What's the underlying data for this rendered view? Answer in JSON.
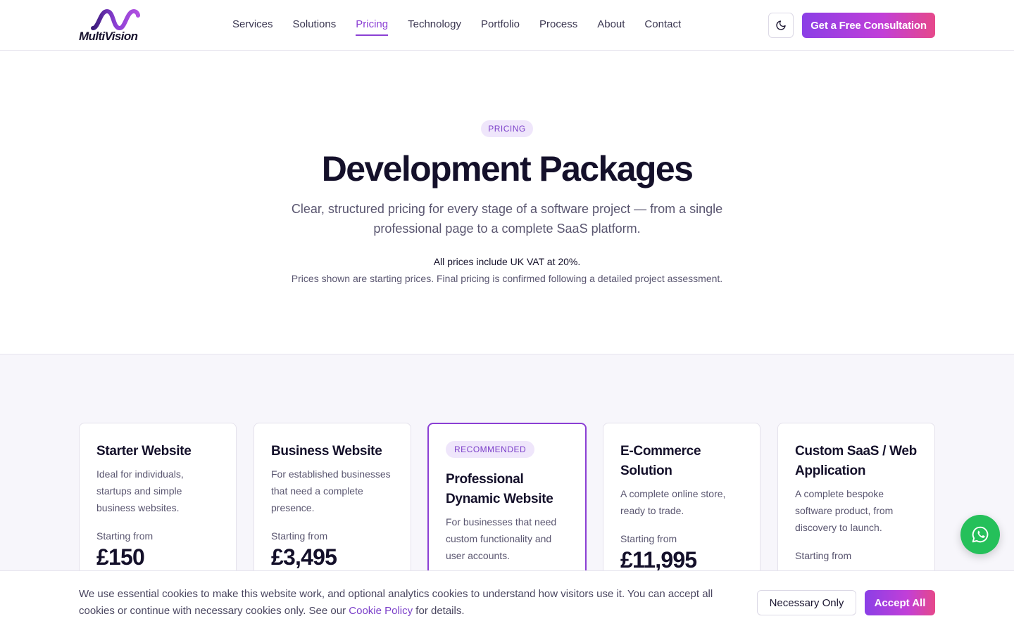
{
  "brand": {
    "name": "MultiVision"
  },
  "nav": {
    "items": [
      {
        "label": "Services"
      },
      {
        "label": "Solutions"
      },
      {
        "label": "Pricing",
        "active": true
      },
      {
        "label": "Technology"
      },
      {
        "label": "Portfolio"
      },
      {
        "label": "Process"
      },
      {
        "label": "About"
      },
      {
        "label": "Contact"
      }
    ],
    "theme_toggle_icon": "moon-icon",
    "cta_label": "Get a Free Consultation"
  },
  "hero": {
    "badge": "PRICING",
    "title": "Development Packages",
    "subtitle": "Clear, structured pricing for every stage of a software project — from a single professional page to a complete SaaS platform.",
    "vat_note": "All prices include UK VAT at 20%.",
    "pricing_note": "Prices shown are starting prices. Final pricing is confirmed following a detailed project assessment."
  },
  "packages": [
    {
      "title": "Starter Website",
      "description": "Ideal for individuals, startups and simple business websites.",
      "from_label": "Starting from",
      "price": "£150"
    },
    {
      "title": "Business Website",
      "description": "For established businesses that need a complete presence.",
      "from_label": "Starting from",
      "price": "£3,495"
    },
    {
      "badge": "RECOMMENDED",
      "title": "Professional Dynamic Website",
      "description": "For businesses that need custom functionality and user accounts.",
      "from_label": "",
      "price": ""
    },
    {
      "title": "E-Commerce Solution",
      "description": "A complete online store, ready to trade.",
      "from_label": "Starting from",
      "price": "£11,995"
    },
    {
      "title": "Custom SaaS / Web Application",
      "description": "A complete bespoke software product, from discovery to launch.",
      "from_label": "Starting from",
      "price": ""
    }
  ],
  "whatsapp": {
    "icon": "whatsapp-icon"
  },
  "cookie": {
    "text_before": "We use essential cookies to make this website work, and optional analytics cookies to understand how visitors use it. You can accept all cookies or continue with necessary cookies only. See our ",
    "link_label": "Cookie Policy",
    "text_after": " for details.",
    "necessary_label": "Necessary Only",
    "accept_label": "Accept All"
  },
  "colors": {
    "accent": "#8b3fd4",
    "gradient_start": "#8b3fe6",
    "gradient_end": "#e6488a",
    "whatsapp": "#25c05a"
  }
}
